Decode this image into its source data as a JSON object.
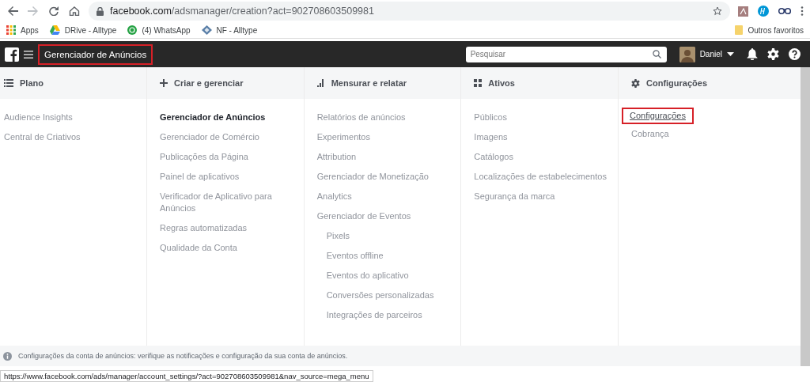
{
  "browser": {
    "url_host": "facebook.com",
    "url_path": "/adsmanager/creation?act=902708603509981",
    "bookmarks": [
      {
        "label": "Apps",
        "kind": "apps"
      },
      {
        "label": "DRive - Alltype",
        "kind": "drive"
      },
      {
        "label": "(4) WhatsApp",
        "kind": "whatsapp"
      },
      {
        "label": "NF - Alltype",
        "kind": "nf"
      }
    ],
    "other_bookmarks": "Outros favoritos"
  },
  "topbar": {
    "title": "Gerenciador de Anúncios",
    "title_highlighted": true,
    "search": {
      "placeholder": "Pesquisar"
    },
    "user": "Daniel"
  },
  "menu": {
    "columns": [
      {
        "title": "Plano",
        "kind": "list",
        "items": [
          {
            "label": "Audience Insights",
            "selected": false,
            "highlighted": false
          },
          {
            "label": "Central de Criativos",
            "selected": false,
            "highlighted": false
          }
        ]
      },
      {
        "title": "Criar e gerenciar",
        "kind": "plus",
        "items": [
          {
            "label": "Gerenciador de Anúncios",
            "selected": true,
            "highlighted": false
          },
          {
            "label": "Gerenciador de Comércio",
            "selected": false,
            "highlighted": false
          },
          {
            "label": "Publicações da Página",
            "selected": false,
            "highlighted": false
          },
          {
            "label": "Painel de aplicativos",
            "selected": false,
            "highlighted": false
          },
          {
            "label": "Verificador de Aplicativo para Anúncios",
            "selected": false,
            "highlighted": false
          },
          {
            "label": "Regras automatizadas",
            "selected": false,
            "highlighted": false
          },
          {
            "label": "Qualidade da Conta",
            "selected": false,
            "highlighted": false
          }
        ]
      },
      {
        "title": "Mensurar e relatar",
        "kind": "chart",
        "items": [
          {
            "label": "Relatórios de anúncios",
            "selected": false,
            "highlighted": false
          },
          {
            "label": "Experimentos",
            "selected": false,
            "highlighted": false
          },
          {
            "label": "Attribution",
            "selected": false,
            "highlighted": false
          },
          {
            "label": "Gerenciador de Monetização",
            "selected": false,
            "highlighted": false
          },
          {
            "label": "Analytics",
            "selected": false,
            "highlighted": false
          },
          {
            "label": "Gerenciador de Eventos",
            "selected": false,
            "highlighted": false,
            "children": [
              {
                "label": "Pixels",
                "selected": false,
                "highlighted": false
              },
              {
                "label": "Eventos offline",
                "selected": false,
                "highlighted": false
              },
              {
                "label": "Eventos do aplicativo",
                "selected": false,
                "highlighted": false
              },
              {
                "label": "Conversões personalizadas",
                "selected": false,
                "highlighted": false
              },
              {
                "label": "Integrações de parceiros",
                "selected": false,
                "highlighted": false
              }
            ]
          }
        ]
      },
      {
        "title": "Ativos",
        "kind": "grid",
        "items": [
          {
            "label": "Públicos",
            "selected": false,
            "highlighted": false
          },
          {
            "label": "Imagens",
            "selected": false,
            "highlighted": false
          },
          {
            "label": "Catálogos",
            "selected": false,
            "highlighted": false
          },
          {
            "label": "Localizações de estabelecimentos",
            "selected": false,
            "highlighted": false
          },
          {
            "label": "Segurança da marca",
            "selected": false,
            "highlighted": false
          }
        ]
      },
      {
        "title": "Configurações",
        "kind": "gear",
        "items": [
          {
            "label": "Configurações",
            "selected": false,
            "highlighted": true
          },
          {
            "label": "Cobrança",
            "selected": false,
            "highlighted": false
          }
        ]
      }
    ],
    "footer": "Configurações da conta de anúncios: verifique as notificações e configuração da sua conta de anúncios."
  },
  "status_url": "https://www.facebook.com/ads/manager/account_settings/?act=902708603509981&nav_source=mega_menu"
}
